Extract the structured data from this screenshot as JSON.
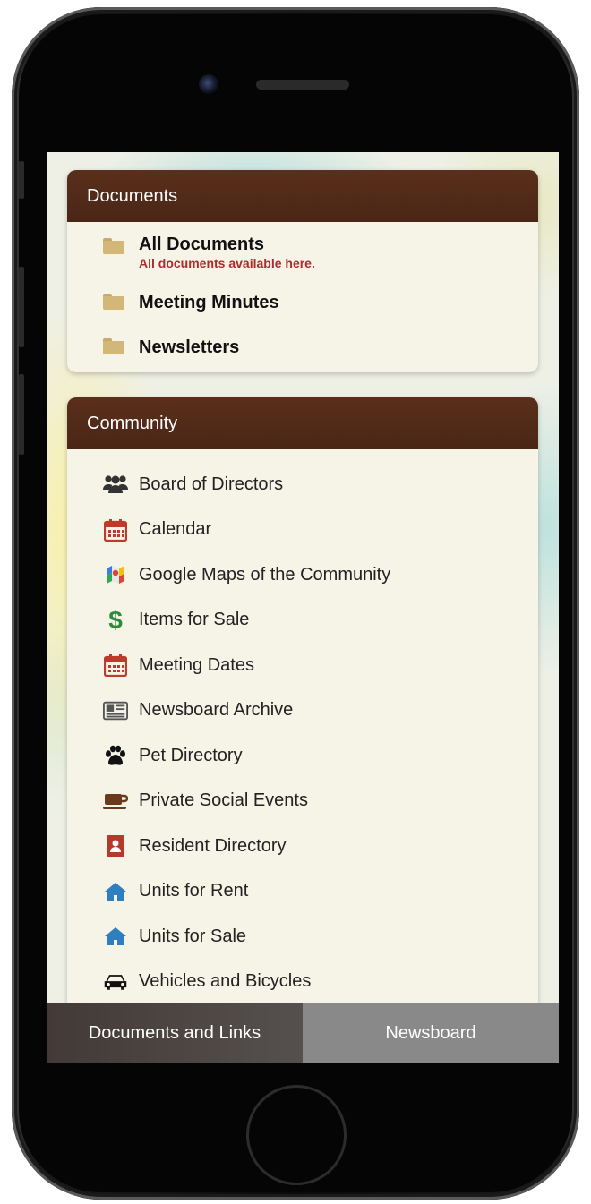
{
  "documents": {
    "header": "Documents",
    "items": [
      {
        "title": "All Documents",
        "subtitle": "All documents available here."
      },
      {
        "title": "Meeting Minutes"
      },
      {
        "title": "Newsletters"
      }
    ]
  },
  "community": {
    "header": "Community",
    "items": [
      {
        "label": "Board of Directors",
        "icon": "group-icon"
      },
      {
        "label": "Calendar",
        "icon": "calendar-icon"
      },
      {
        "label": "Google Maps of the Community",
        "icon": "google-maps-icon"
      },
      {
        "label": "Items for Sale",
        "icon": "dollar-icon"
      },
      {
        "label": "Meeting Dates",
        "icon": "calendar-icon"
      },
      {
        "label": "Newsboard Archive",
        "icon": "newspaper-icon"
      },
      {
        "label": "Pet Directory",
        "icon": "paw-icon"
      },
      {
        "label": "Private Social Events",
        "icon": "coffee-cup-icon"
      },
      {
        "label": "Resident Directory",
        "icon": "address-book-icon"
      },
      {
        "label": "Units for Rent",
        "icon": "home-icon"
      },
      {
        "label": "Units for Sale",
        "icon": "home-icon"
      },
      {
        "label": "Vehicles and Bicycles",
        "icon": "car-icon"
      }
    ]
  },
  "tabbar": {
    "documents_tab": "Documents and Links",
    "newsboard_tab": "Newsboard"
  },
  "colors": {
    "header_brown": "#4f2918",
    "subtitle_red": "#b02a2a",
    "calendar_red": "#c0392b",
    "dollar_green": "#2e8b3a",
    "home_blue": "#2f7fc0",
    "folder_tan": "#d3b778"
  }
}
